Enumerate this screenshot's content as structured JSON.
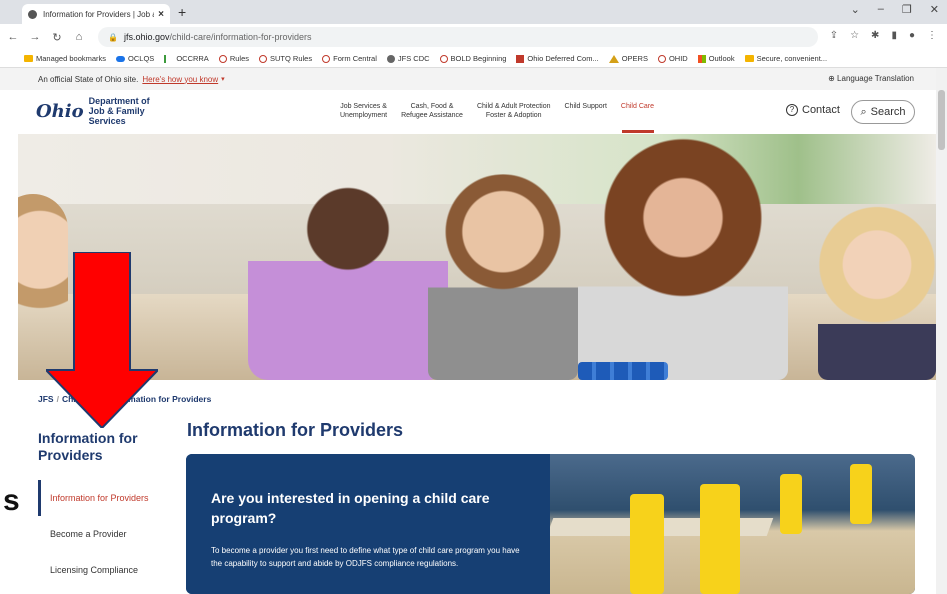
{
  "browser": {
    "tab_title": "Information for Providers | Job a...",
    "url_domain": "jfs.ohio.gov",
    "url_path": "/child-care/information-for-providers"
  },
  "bookmarks": [
    {
      "label": "Managed bookmarks",
      "icon": "folder-icon"
    },
    {
      "label": "OCLQS",
      "icon": "blue-globe-icon"
    },
    {
      "label": "OCCRRA",
      "icon": "green-icon"
    },
    {
      "label": "Rules",
      "icon": "circle-icon"
    },
    {
      "label": "SUTQ Rules",
      "icon": "circle-icon"
    },
    {
      "label": "Form Central",
      "icon": "circle-icon"
    },
    {
      "label": "JFS CDC",
      "icon": "globe-icon"
    },
    {
      "label": "BOLD Beginning",
      "icon": "circle-icon"
    },
    {
      "label": "Ohio Deferred Com...",
      "icon": "red-square-icon"
    },
    {
      "label": "OPERS",
      "icon": "triangle-icon"
    },
    {
      "label": "OHID",
      "icon": "circle-icon"
    },
    {
      "label": "Outlook",
      "icon": "microsoft-icon"
    },
    {
      "label": "Secure, convenient...",
      "icon": "hand-icon"
    }
  ],
  "banner": {
    "official_text": "An official State of Ohio site.",
    "how_link": "Here's how you know",
    "language": "Language Translation"
  },
  "header": {
    "logo_word": "Ohio",
    "dept_line1": "Department of",
    "dept_line2": "Job & Family",
    "dept_line3": "Services",
    "nav": [
      {
        "line1": "Job Services &",
        "line2": "Unemployment"
      },
      {
        "line1": "Cash, Food &",
        "line2": "Refugee Assistance"
      },
      {
        "line1": "Child & Adult Protection",
        "line2": "Foster & Adoption"
      },
      {
        "line1": "Child Support",
        "line2": ""
      },
      {
        "line1": "Child Care",
        "line2": ""
      }
    ],
    "contact": "Contact",
    "search": "Search"
  },
  "breadcrumb": {
    "root": "JFS",
    "middle": "Chi",
    "current": "ormation for Providers"
  },
  "sidebar": {
    "title": "Information for Providers",
    "items": [
      {
        "label": "Information for Providers",
        "active": true
      },
      {
        "label": "Become a Provider",
        "active": false
      },
      {
        "label": "Licensing Compliance",
        "active": false
      }
    ],
    "edge_char": "s"
  },
  "main": {
    "heading": "Information for Providers",
    "promo_question": "Are you interested in opening a child care program?",
    "promo_body": "To become a provider you first need to define what type of child care program you have the capability to support and abide by ODJFS compliance regulations."
  },
  "colors": {
    "brand_navy": "#1f3a6e",
    "accent_red": "#c0392b",
    "promo_bg": "#163f73",
    "arrow_red": "#ff0000"
  }
}
